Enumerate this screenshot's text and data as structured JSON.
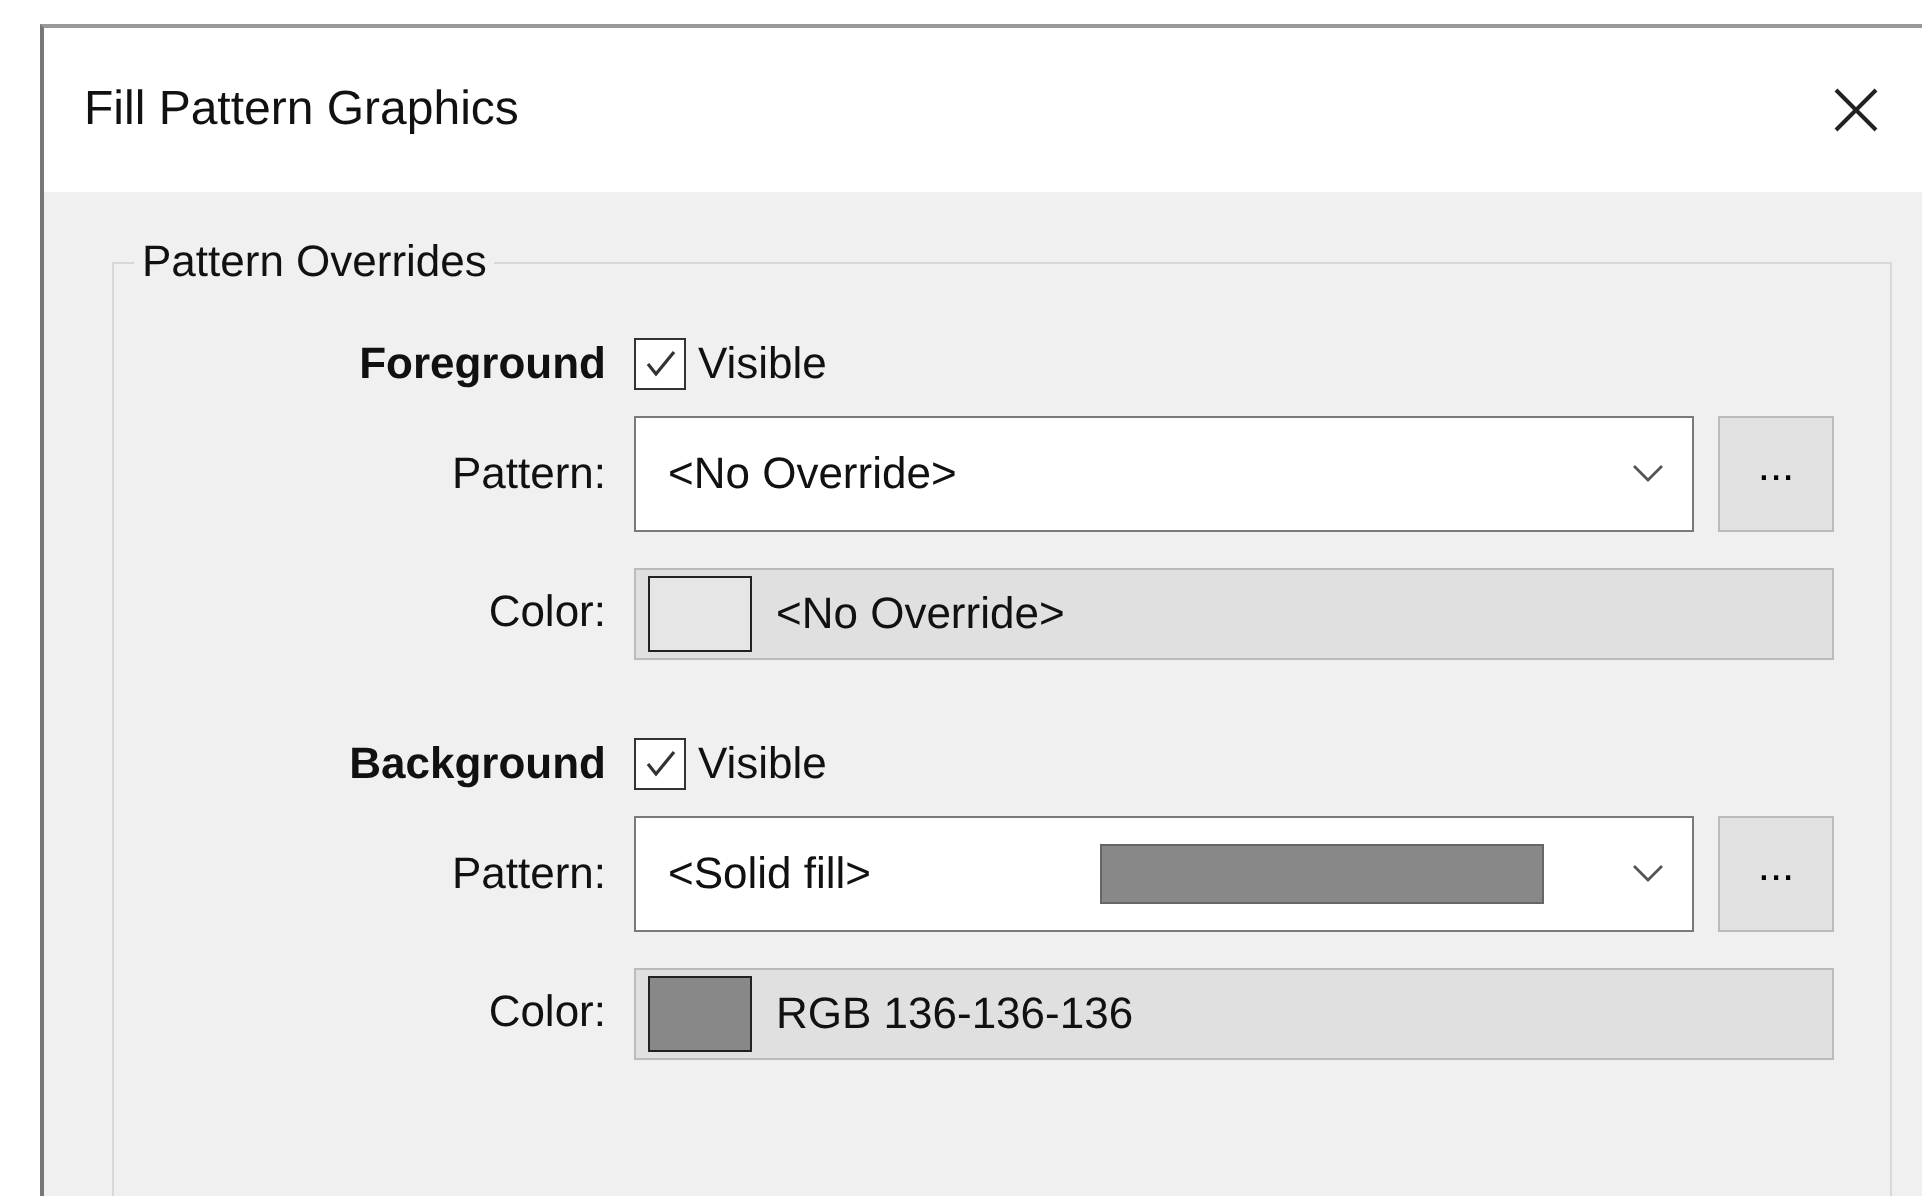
{
  "window": {
    "title": "Fill Pattern Graphics"
  },
  "group": {
    "title": "Pattern Overrides",
    "sections": [
      {
        "heading": "Foreground",
        "visible_label": "Visible",
        "visible": true,
        "pattern_label": "Pattern:",
        "pattern": "<No Override>",
        "browse": "...",
        "color_label": "Color:",
        "swatch": {
          "color": "#e6e6e6"
        },
        "color_text": "<No Override>"
      },
      {
        "heading": "Background",
        "visible_label": "Visible",
        "visible": true,
        "pattern_label": "Pattern:",
        "pattern": "<Solid fill>",
        "pattern_swatch": {
          "color": "#888888"
        },
        "browse": "...",
        "color_label": "Color:",
        "swatch": {
          "color": "#888888"
        },
        "color_text": "RGB 136-136-136"
      }
    ]
  }
}
